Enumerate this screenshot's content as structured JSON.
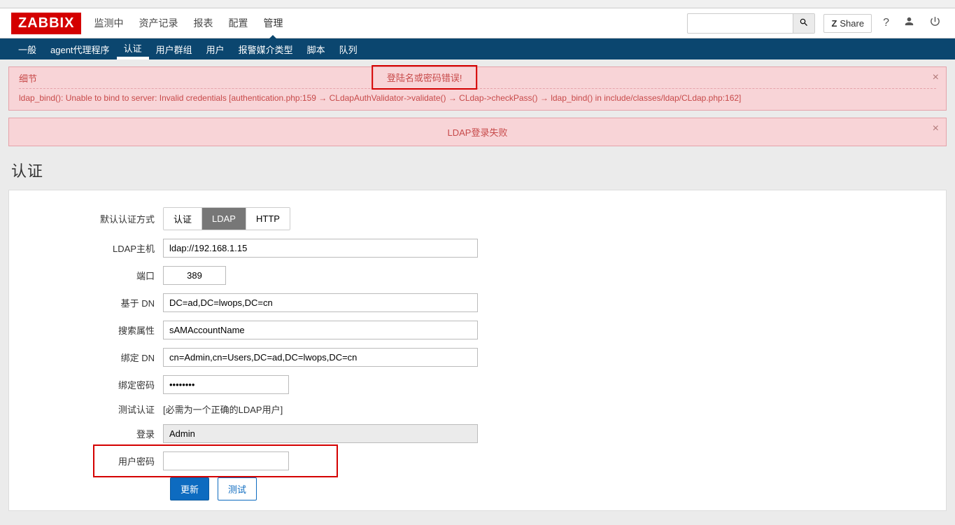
{
  "logo": "ZABBIX",
  "topnav": {
    "items": [
      {
        "label": "监测中"
      },
      {
        "label": "资产记录"
      },
      {
        "label": "报表"
      },
      {
        "label": "配置"
      },
      {
        "label": "管理"
      }
    ]
  },
  "subnav": {
    "items": [
      {
        "label": "一般"
      },
      {
        "label": "agent代理程序"
      },
      {
        "label": "认证"
      },
      {
        "label": "用户群组"
      },
      {
        "label": "用户"
      },
      {
        "label": "报警媒介类型"
      },
      {
        "label": "脚本"
      },
      {
        "label": "队列"
      }
    ]
  },
  "share_label": "Share",
  "error1": {
    "title": "登陆名或密码错误!",
    "detail_header": "细节",
    "detail_line": "ldap_bind(): Unable to bind to server: Invalid credentials [authentication.php:159 → CLdapAuthValidator->validate() → CLdap->checkPass() → ldap_bind() in include/classes/ldap/CLdap.php:162]"
  },
  "error2": {
    "text": "LDAP登录失败"
  },
  "page_title": "认证",
  "form": {
    "default_auth_label": "默认认证方式",
    "auth_options": [
      "认证",
      "LDAP",
      "HTTP"
    ],
    "ldap_host_label": "LDAP主机",
    "ldap_host_value": "ldap://192.168.1.15",
    "port_label": "端口",
    "port_value": "389",
    "base_dn_label": "基于 DN",
    "base_dn_value": "DC=ad,DC=lwops,DC=cn",
    "search_attr_label": "搜索属性",
    "search_attr_value": "sAMAccountName",
    "bind_dn_label": "绑定 DN",
    "bind_dn_value": "cn=Admin,cn=Users,DC=ad,DC=lwops,DC=cn",
    "bind_pw_label": "绑定密码",
    "bind_pw_value": "••••••••",
    "test_auth_label": "测试认证",
    "test_auth_note": "[必需为一个正确的LDAP用户]",
    "login_label": "登录",
    "login_value": "Admin",
    "user_pw_label": "用户密码",
    "user_pw_value": "",
    "update_btn": "更新",
    "test_btn": "测试"
  }
}
